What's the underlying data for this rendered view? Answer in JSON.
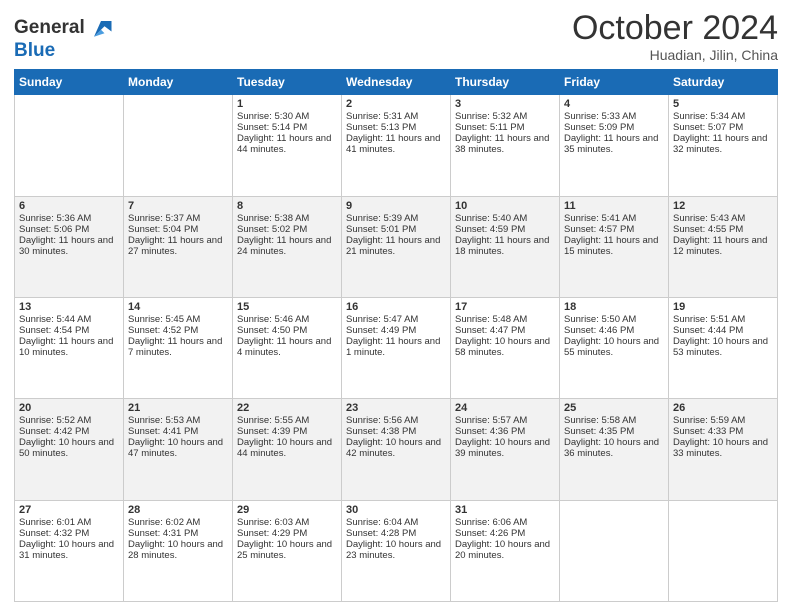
{
  "header": {
    "logo_line1": "General",
    "logo_line2": "Blue",
    "month": "October 2024",
    "location": "Huadian, Jilin, China"
  },
  "days_of_week": [
    "Sunday",
    "Monday",
    "Tuesday",
    "Wednesday",
    "Thursday",
    "Friday",
    "Saturday"
  ],
  "weeks": [
    [
      {
        "day": "",
        "content": ""
      },
      {
        "day": "",
        "content": ""
      },
      {
        "day": "1",
        "content": "Sunrise: 5:30 AM\nSunset: 5:14 PM\nDaylight: 11 hours and 44 minutes."
      },
      {
        "day": "2",
        "content": "Sunrise: 5:31 AM\nSunset: 5:13 PM\nDaylight: 11 hours and 41 minutes."
      },
      {
        "day": "3",
        "content": "Sunrise: 5:32 AM\nSunset: 5:11 PM\nDaylight: 11 hours and 38 minutes."
      },
      {
        "day": "4",
        "content": "Sunrise: 5:33 AM\nSunset: 5:09 PM\nDaylight: 11 hours and 35 minutes."
      },
      {
        "day": "5",
        "content": "Sunrise: 5:34 AM\nSunset: 5:07 PM\nDaylight: 11 hours and 32 minutes."
      }
    ],
    [
      {
        "day": "6",
        "content": "Sunrise: 5:36 AM\nSunset: 5:06 PM\nDaylight: 11 hours and 30 minutes."
      },
      {
        "day": "7",
        "content": "Sunrise: 5:37 AM\nSunset: 5:04 PM\nDaylight: 11 hours and 27 minutes."
      },
      {
        "day": "8",
        "content": "Sunrise: 5:38 AM\nSunset: 5:02 PM\nDaylight: 11 hours and 24 minutes."
      },
      {
        "day": "9",
        "content": "Sunrise: 5:39 AM\nSunset: 5:01 PM\nDaylight: 11 hours and 21 minutes."
      },
      {
        "day": "10",
        "content": "Sunrise: 5:40 AM\nSunset: 4:59 PM\nDaylight: 11 hours and 18 minutes."
      },
      {
        "day": "11",
        "content": "Sunrise: 5:41 AM\nSunset: 4:57 PM\nDaylight: 11 hours and 15 minutes."
      },
      {
        "day": "12",
        "content": "Sunrise: 5:43 AM\nSunset: 4:55 PM\nDaylight: 11 hours and 12 minutes."
      }
    ],
    [
      {
        "day": "13",
        "content": "Sunrise: 5:44 AM\nSunset: 4:54 PM\nDaylight: 11 hours and 10 minutes."
      },
      {
        "day": "14",
        "content": "Sunrise: 5:45 AM\nSunset: 4:52 PM\nDaylight: 11 hours and 7 minutes."
      },
      {
        "day": "15",
        "content": "Sunrise: 5:46 AM\nSunset: 4:50 PM\nDaylight: 11 hours and 4 minutes."
      },
      {
        "day": "16",
        "content": "Sunrise: 5:47 AM\nSunset: 4:49 PM\nDaylight: 11 hours and 1 minute."
      },
      {
        "day": "17",
        "content": "Sunrise: 5:48 AM\nSunset: 4:47 PM\nDaylight: 10 hours and 58 minutes."
      },
      {
        "day": "18",
        "content": "Sunrise: 5:50 AM\nSunset: 4:46 PM\nDaylight: 10 hours and 55 minutes."
      },
      {
        "day": "19",
        "content": "Sunrise: 5:51 AM\nSunset: 4:44 PM\nDaylight: 10 hours and 53 minutes."
      }
    ],
    [
      {
        "day": "20",
        "content": "Sunrise: 5:52 AM\nSunset: 4:42 PM\nDaylight: 10 hours and 50 minutes."
      },
      {
        "day": "21",
        "content": "Sunrise: 5:53 AM\nSunset: 4:41 PM\nDaylight: 10 hours and 47 minutes."
      },
      {
        "day": "22",
        "content": "Sunrise: 5:55 AM\nSunset: 4:39 PM\nDaylight: 10 hours and 44 minutes."
      },
      {
        "day": "23",
        "content": "Sunrise: 5:56 AM\nSunset: 4:38 PM\nDaylight: 10 hours and 42 minutes."
      },
      {
        "day": "24",
        "content": "Sunrise: 5:57 AM\nSunset: 4:36 PM\nDaylight: 10 hours and 39 minutes."
      },
      {
        "day": "25",
        "content": "Sunrise: 5:58 AM\nSunset: 4:35 PM\nDaylight: 10 hours and 36 minutes."
      },
      {
        "day": "26",
        "content": "Sunrise: 5:59 AM\nSunset: 4:33 PM\nDaylight: 10 hours and 33 minutes."
      }
    ],
    [
      {
        "day": "27",
        "content": "Sunrise: 6:01 AM\nSunset: 4:32 PM\nDaylight: 10 hours and 31 minutes."
      },
      {
        "day": "28",
        "content": "Sunrise: 6:02 AM\nSunset: 4:31 PM\nDaylight: 10 hours and 28 minutes."
      },
      {
        "day": "29",
        "content": "Sunrise: 6:03 AM\nSunset: 4:29 PM\nDaylight: 10 hours and 25 minutes."
      },
      {
        "day": "30",
        "content": "Sunrise: 6:04 AM\nSunset: 4:28 PM\nDaylight: 10 hours and 23 minutes."
      },
      {
        "day": "31",
        "content": "Sunrise: 6:06 AM\nSunset: 4:26 PM\nDaylight: 10 hours and 20 minutes."
      },
      {
        "day": "",
        "content": ""
      },
      {
        "day": "",
        "content": ""
      }
    ]
  ]
}
